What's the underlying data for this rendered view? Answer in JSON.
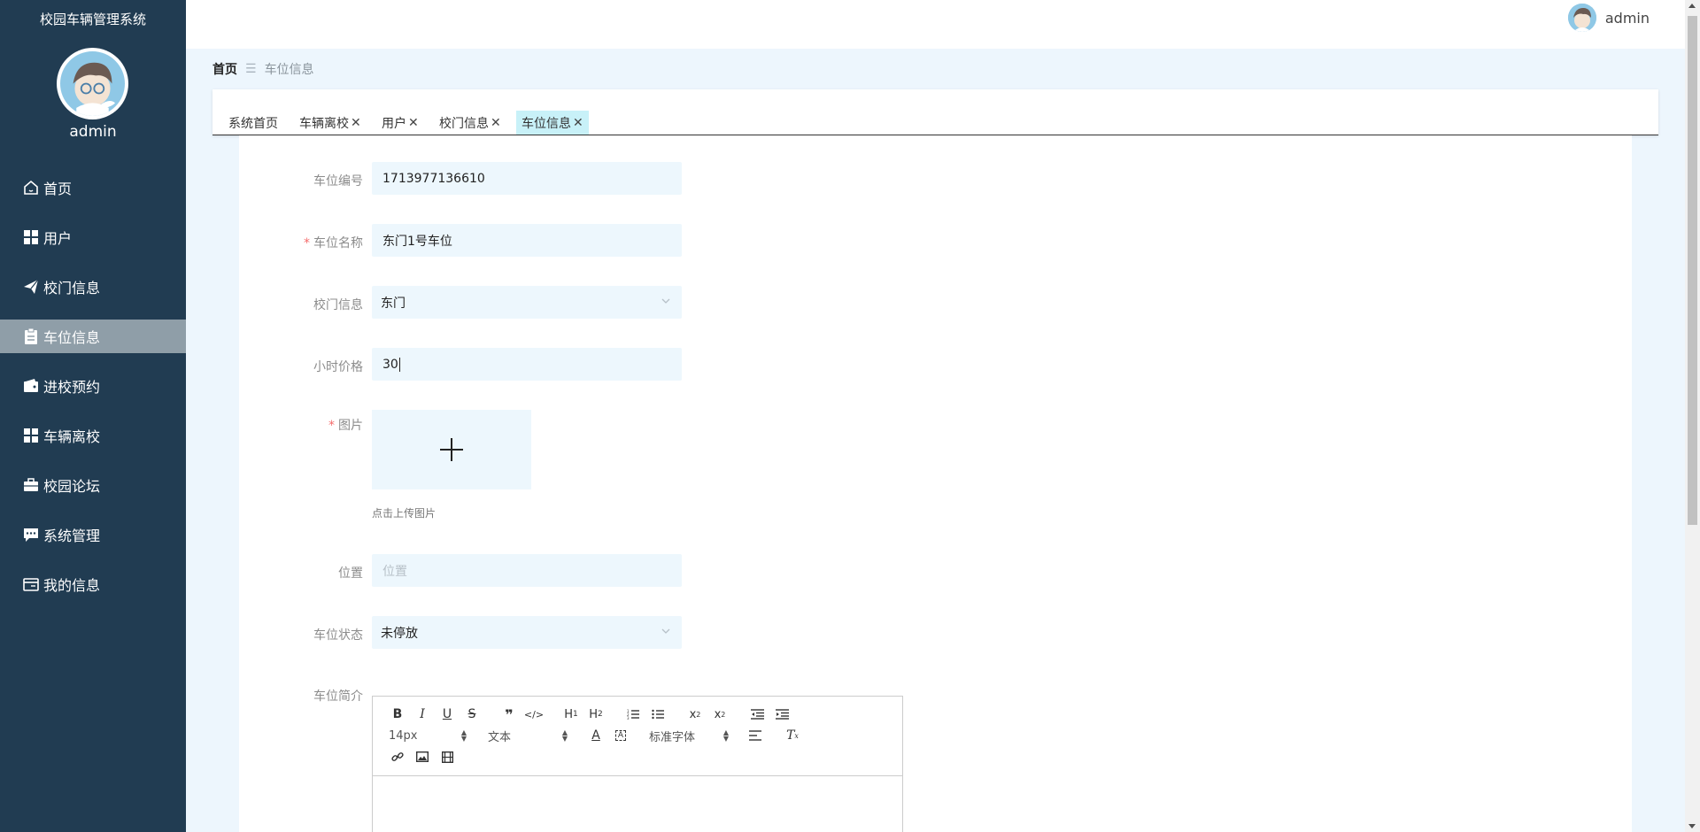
{
  "app": {
    "title": "校园车辆管理系统"
  },
  "user": {
    "name": "admin"
  },
  "sidebar": {
    "items": [
      {
        "label": "首页",
        "icon": "home-icon"
      },
      {
        "label": "用户",
        "icon": "grid-icon"
      },
      {
        "label": "校门信息",
        "icon": "paper-plane-icon"
      },
      {
        "label": "车位信息",
        "icon": "clipboard-icon",
        "active": true
      },
      {
        "label": "进校预约",
        "icon": "wallet-icon"
      },
      {
        "label": "车辆离校",
        "icon": "grid-icon"
      },
      {
        "label": "校园论坛",
        "icon": "briefcase-icon"
      },
      {
        "label": "系统管理",
        "icon": "chat-icon"
      },
      {
        "label": "我的信息",
        "icon": "card-icon"
      }
    ]
  },
  "breadcrumb": {
    "home": "首页",
    "separator": "☰",
    "current": "车位信息"
  },
  "tabs": [
    {
      "label": "系统首页",
      "closable": false
    },
    {
      "label": "车辆离校",
      "closable": true
    },
    {
      "label": "用户",
      "closable": true
    },
    {
      "label": "校门信息",
      "closable": true
    },
    {
      "label": "车位信息",
      "closable": true,
      "active": true
    }
  ],
  "form": {
    "code": {
      "label": "车位编号",
      "value": "1713977136610",
      "required": false
    },
    "name": {
      "label": "车位名称",
      "value": "东门1号车位",
      "required": true
    },
    "gate": {
      "label": "校门信息",
      "value": "东门",
      "required": false
    },
    "price": {
      "label": "小时价格",
      "value": "30",
      "required": false
    },
    "image": {
      "label": "图片",
      "hint": "点击上传图片",
      "required": true
    },
    "location": {
      "label": "位置",
      "placeholder": "位置",
      "value": "",
      "required": false
    },
    "status": {
      "label": "车位状态",
      "value": "未停放",
      "required": false
    },
    "intro": {
      "label": "车位简介"
    }
  },
  "editor": {
    "font_size": "14px",
    "heading_select": "文本",
    "font_family": "标准字体"
  },
  "colors": {
    "sidebar_bg": "#213c52",
    "sidebar_active": "#8f9ea8",
    "tab_active": "#c8f1f8",
    "field_bg": "#edf7fd",
    "required": "#f56c6c"
  }
}
